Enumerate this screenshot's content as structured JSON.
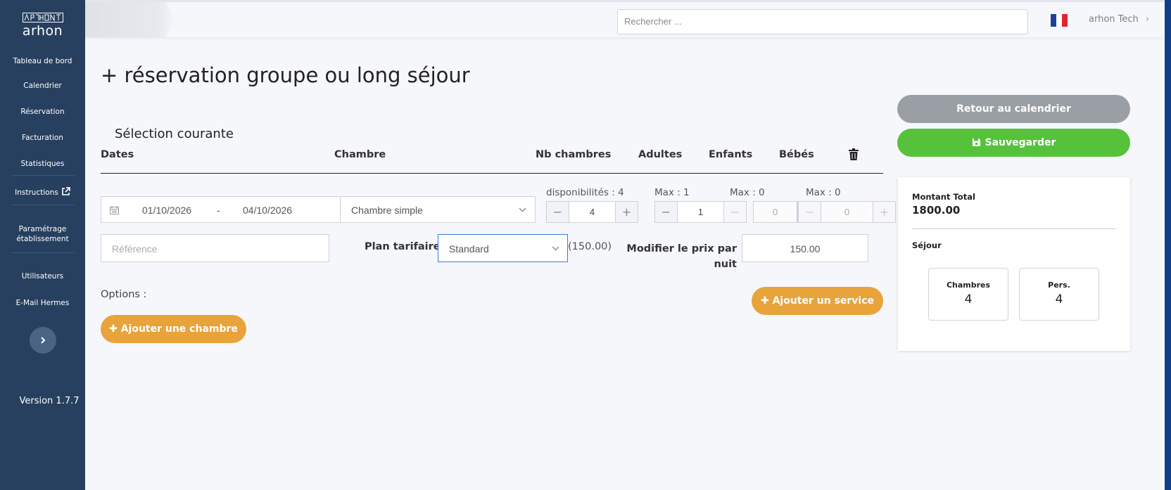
{
  "sidebar": {
    "logo_text": "arhon",
    "items": [
      {
        "label": "Tableau de bord"
      },
      {
        "label": "Calendrier"
      },
      {
        "label": "Réservation"
      },
      {
        "label": "Facturation"
      },
      {
        "label": "Statistiques"
      },
      {
        "label": "Instructions"
      },
      {
        "label": "Paramétrage"
      },
      {
        "label": "établissement"
      },
      {
        "label": "Utilisateurs"
      },
      {
        "label": "E-Mail Hermes"
      }
    ],
    "version": "Version 1.7.7"
  },
  "header": {
    "search_placeholder": "Rechercher ...",
    "language_flag": "fr",
    "flag_colors": [
      "#1f3f99",
      "#ffffff",
      "#e0252d"
    ],
    "user_name": "arhon Tech"
  },
  "page": {
    "title": "+ réservation groupe ou long séjour",
    "section_title": "Sélection courante",
    "columns": {
      "dates": "Dates",
      "room": "Chambre",
      "nb_rooms": "Nb chambres",
      "adults": "Adultes",
      "children": "Enfants",
      "babies": "Bébés"
    },
    "booking": {
      "date_from": "01/10/2026",
      "date_sep": "-",
      "date_to": "04/10/2026",
      "room_type": "Chambre simple",
      "availability": "disponibilités : 4",
      "nb_rooms_value": "4",
      "adults_max": "Max : 1",
      "adults_value": "1",
      "children_max": "Max : 0",
      "children_value": "0",
      "babies_max": "Max : 0",
      "babies_value": "0",
      "reference_placeholder": "Référence",
      "rate_plan_label": "Plan tarifaire",
      "rate_plan_value": "Standard",
      "rate_plan_price": "(150.00)",
      "price_label_line1": "Modifier le prix par",
      "price_label_line2": "nuit",
      "price_value": "150.00"
    },
    "options_label": "Options :",
    "add_service": "Ajouter un service",
    "add_room": "Ajouter une chambre"
  },
  "actions": {
    "back": "Retour au calendrier",
    "save": "Sauvegarder"
  },
  "summary": {
    "total_label": "Montant Total",
    "total_value": "1800.00",
    "stay_label": "Séjour",
    "rooms_label": "Chambres",
    "rooms_value": "4",
    "persons_label": "Pers.",
    "persons_value": "4"
  },
  "colors": {
    "sidebar": "#27405f",
    "accent_orange": "#e8a33b",
    "accent_green": "#56c23b",
    "accent_gray": "#9a9ea5",
    "focus_blue": "#3b7bd8"
  }
}
